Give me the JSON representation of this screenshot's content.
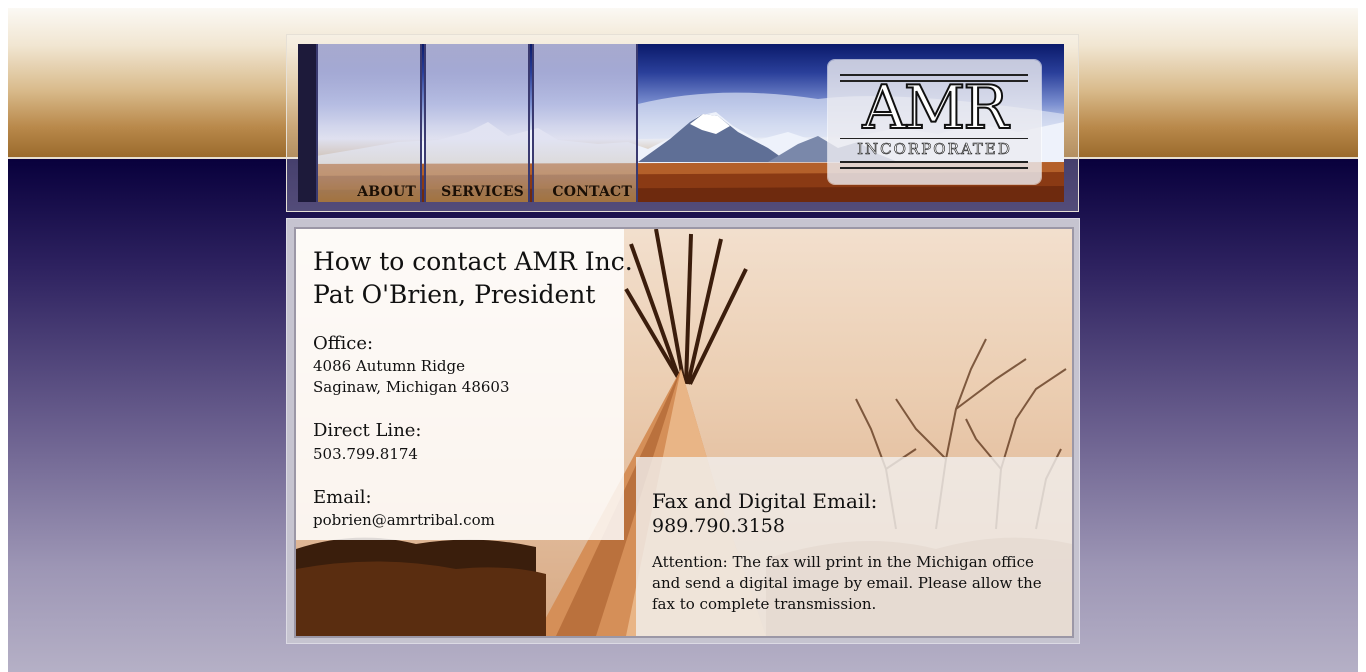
{
  "header": {
    "nav": [
      {
        "label": "ABOUT"
      },
      {
        "label": "SERVICES"
      },
      {
        "label": "CONTACT"
      }
    ],
    "logo": {
      "main": "AMR",
      "sub": "INCORPORATED"
    }
  },
  "contact": {
    "heading_line1": "How to contact AMR Inc.",
    "heading_line2": "Pat O'Brien, President",
    "office": {
      "label": "Office:",
      "address_line1": "4086 Autumn Ridge",
      "address_line2": "Saginaw, Michigan  48603"
    },
    "direct": {
      "label": "Direct Line:",
      "value": "503.799.8174"
    },
    "email": {
      "label": "Email:",
      "value": "pobrien@amrtribal.com"
    },
    "fax": {
      "label": "Fax and Digital Email:",
      "value": "989.790.3158",
      "note": "Attention: The fax will print in the Michigan office and send a digital image by email.  Please allow the fax to complete transmission."
    }
  },
  "colors": {
    "navy": "#05003a",
    "gold": "#b9894b",
    "lavender": "#b5b0c6"
  }
}
